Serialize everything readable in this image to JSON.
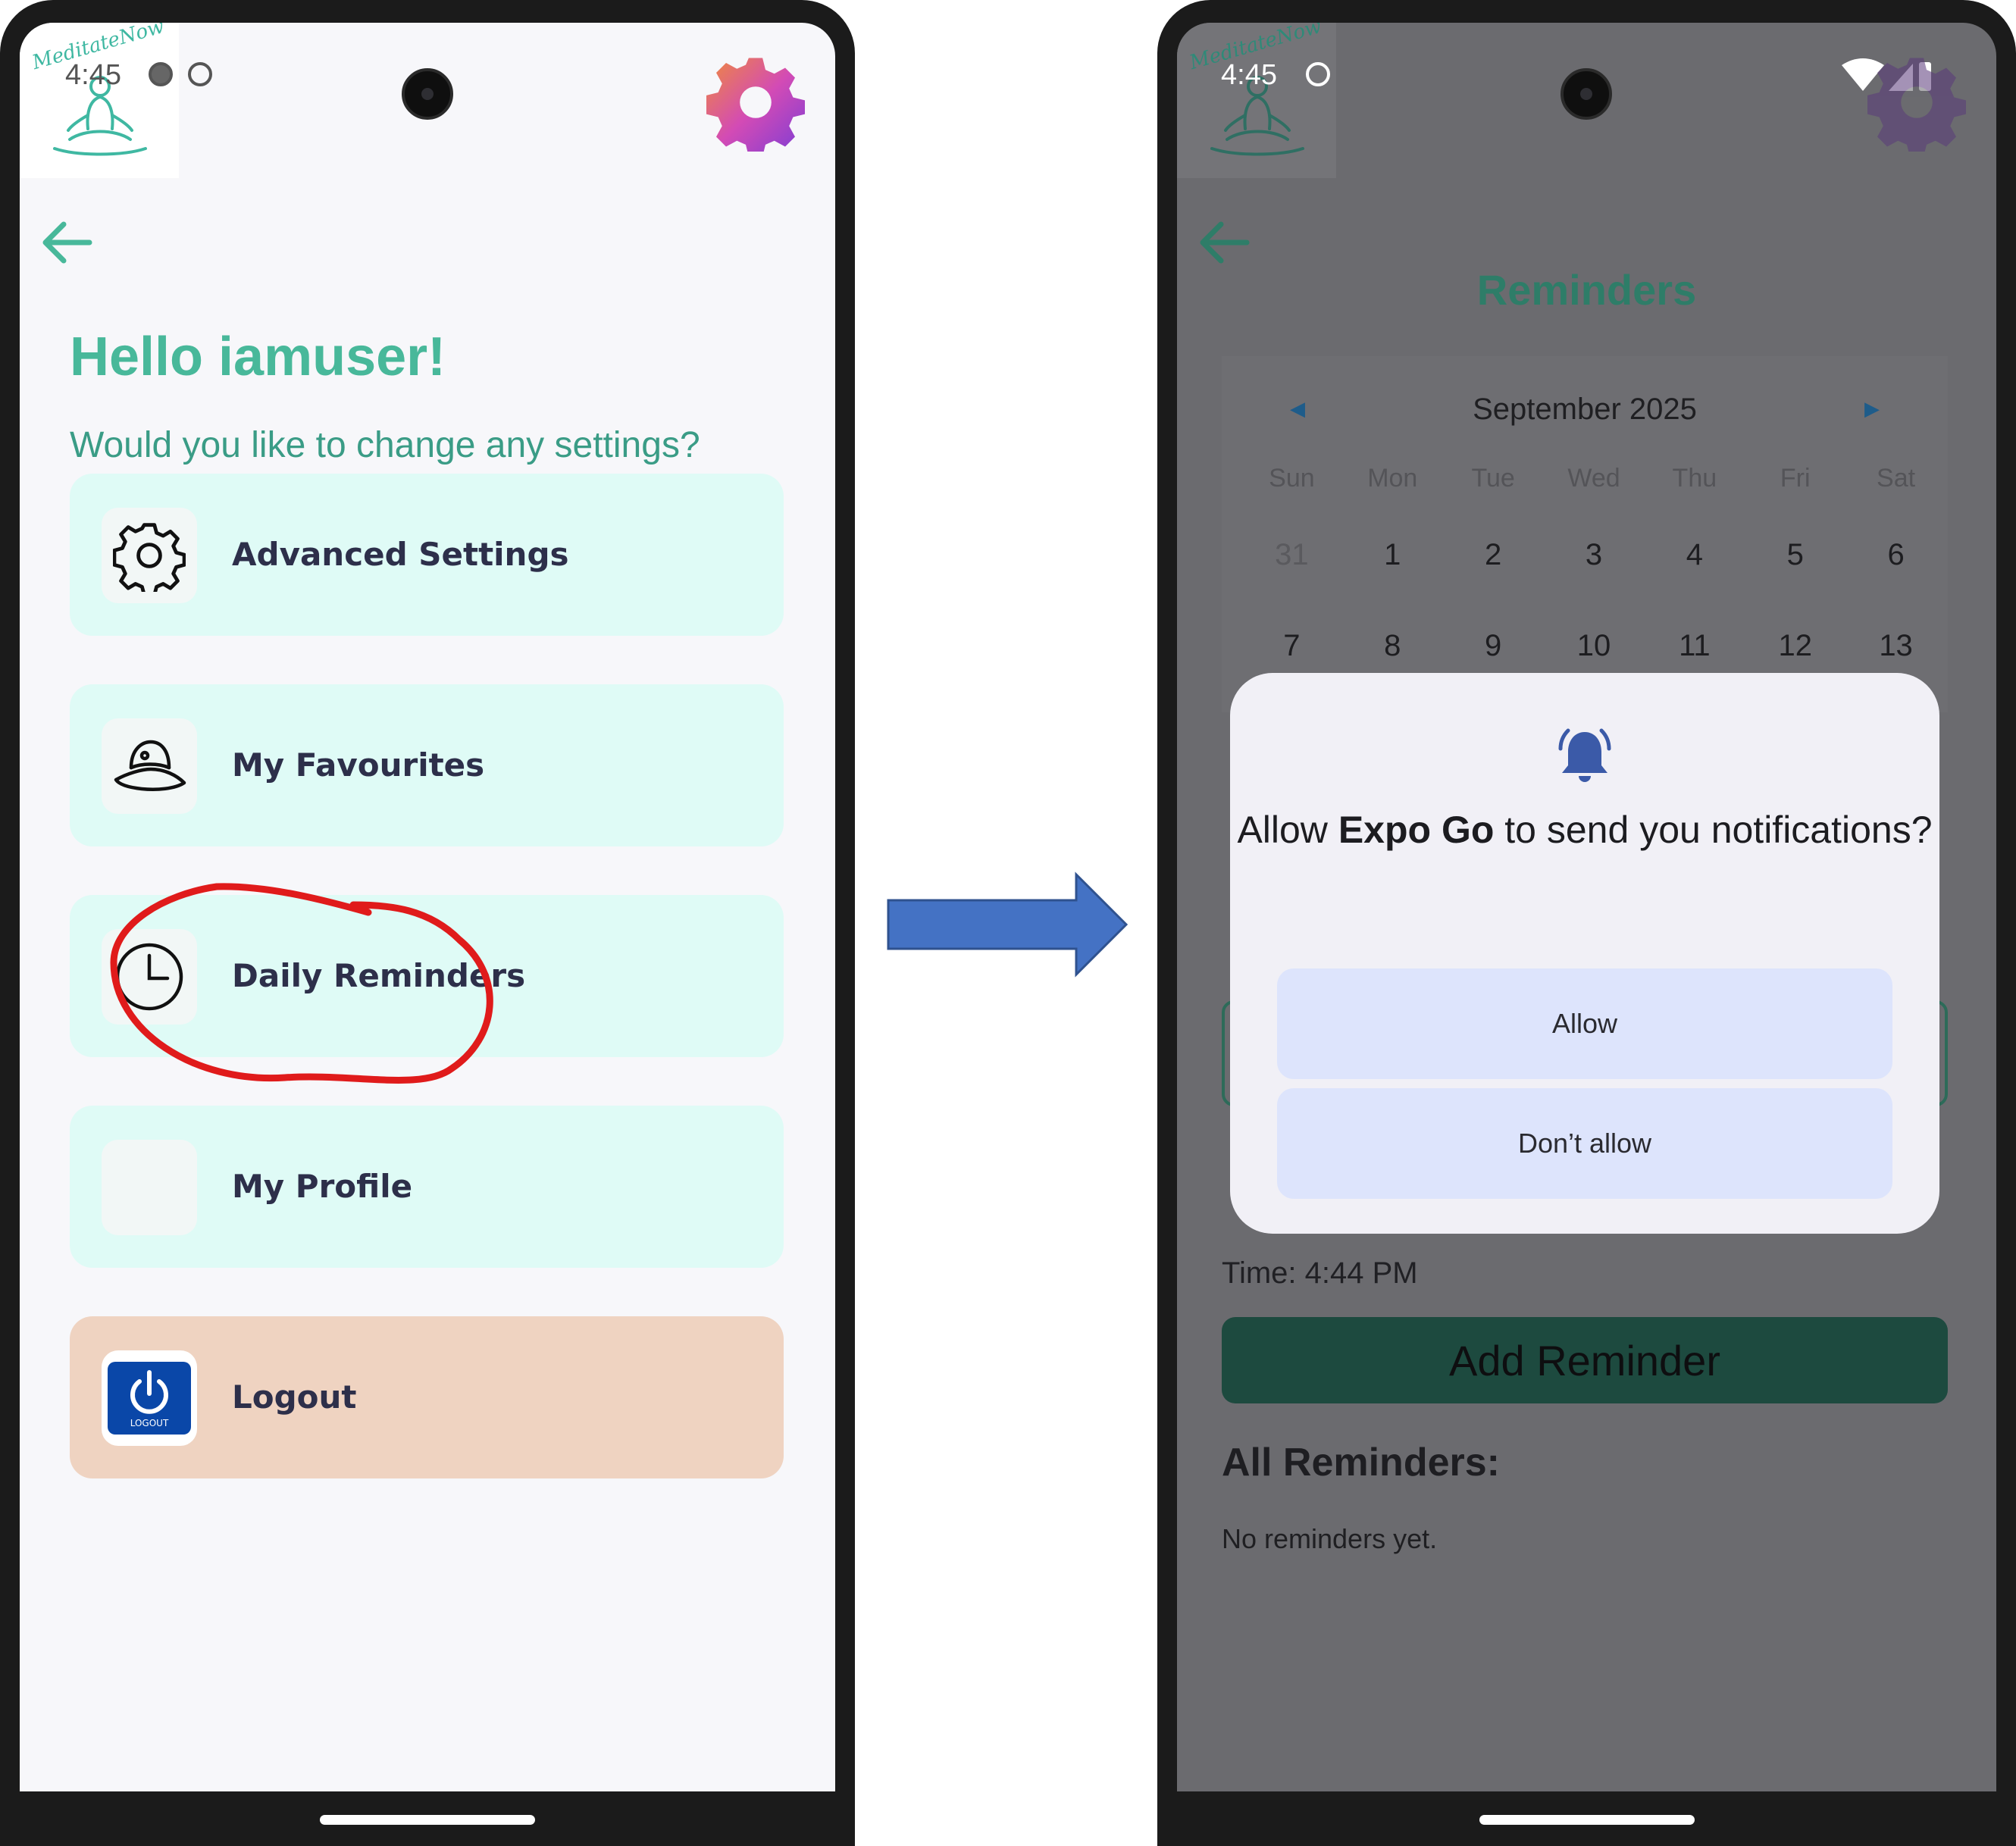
{
  "left_screen": {
    "logo_text": "MeditateNow",
    "status_time": "4:45",
    "greeting": "Hello iamuser!",
    "subtitle": "Would you like to change any settings?",
    "menu_items": [
      {
        "label": "Advanced Settings",
        "icon": "gear-icon"
      },
      {
        "label": "My Favourites",
        "icon": "hat-icon"
      },
      {
        "label": "Daily Reminders",
        "icon": "clock-icon"
      },
      {
        "label": "My Profile",
        "icon": "blank-icon"
      },
      {
        "label": "Logout",
        "icon": "power-icon"
      }
    ],
    "logout_badge_text": "LOGOUT",
    "colors": {
      "accent": "#48b89a",
      "card": "#dffbf6",
      "logout_card": "#efd3c1",
      "annotation": "#e01b1b"
    }
  },
  "right_screen": {
    "logo_text": "MeditateNow",
    "status_time": "4:45",
    "title": "Reminders",
    "calendar": {
      "month": "September 2025",
      "weekdays": [
        "Sun",
        "Mon",
        "Tue",
        "Wed",
        "Thu",
        "Fri",
        "Sat"
      ],
      "weeks": [
        [
          "31",
          "1",
          "2",
          "3",
          "4",
          "5",
          "6"
        ],
        [
          "7",
          "8",
          "9",
          "10",
          "11",
          "12",
          "13"
        ]
      ]
    },
    "time_text": "Time: 4:44 PM",
    "add_button": "Add Reminder",
    "all_title": "All Reminders:",
    "empty_text": "No reminders yet.",
    "dialog": {
      "prefix": "Allow ",
      "app_name": "Expo Go",
      "suffix": " to send you notifications?",
      "allow": "Allow",
      "deny": "Don’t allow"
    }
  },
  "arrow_color": "#4472c4"
}
